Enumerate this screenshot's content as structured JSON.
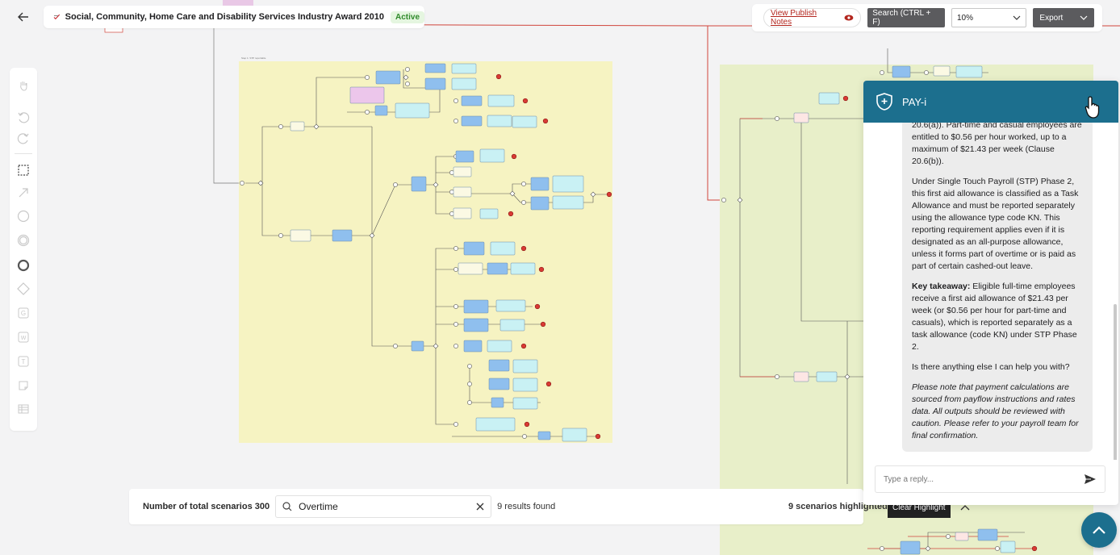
{
  "header": {
    "title": "Social, Community, Home Care and Disability Services Industry Award 2010",
    "status": "Active"
  },
  "toolbar": {
    "publish_notes": "View Publish Notes",
    "search": "Search (CTRL + F)",
    "zoom": "10%",
    "export": "Export"
  },
  "left_tools": [
    "hand-icon",
    "undo-icon",
    "redo-icon",
    "select-box-icon",
    "arrow-icon",
    "circle-icon",
    "double-circle-icon",
    "thick-circle-icon",
    "diamond-icon",
    "gateway-icon",
    "word-icon",
    "text-icon",
    "note-icon",
    "table-icon"
  ],
  "bottom": {
    "total_label": "Number of total scenarios 300",
    "search_value": "Overtime",
    "results": "9 results found",
    "highlighted": "9 scenarios highlighted",
    "clear": "Clear Highlight"
  },
  "chat": {
    "title": "PAY-i",
    "paragraphs": [
      "20.6(a)). Part-time and casual employees are entitled to $0.56 per hour worked, up to a maximum of $21.43 per week (Clause 20.6(b)).",
      "Under Single Touch Payroll (STP) Phase 2, this first aid allowance is classified as a Task Allowance and must be reported separately using the allowance type code KN. This reporting requirement applies even if it is designated as an all-purpose allowance, unless it forms part of overtime or is paid as part of certain cashed-out leave."
    ],
    "takeaway_label": "Key takeaway:",
    "takeaway_text": " Eligible full-time employees receive a first aid allowance of $21.43 per week (or $0.56 per hour for part-time and casuals), which is reported separately as a task allowance (code KN) under STP Phase 2.",
    "question": "Is there anything else I can help you with?",
    "note": "Please note that payment calculations are sourced from payflow instructions and rates data. All outputs should be reviewed with caution. Please refer to your payroll team for final confirmation.",
    "input_placeholder": "Type a reply..."
  },
  "colors": {
    "accent": "#1c6f8e",
    "canvas_yellow": "#f6f3c2",
    "canvas_green": "#e8efc9",
    "task_blue": "#8fbfee",
    "task_cyan": "#c9f1f4",
    "end_red": "#d93a34",
    "flow_red": "#d0453c"
  }
}
